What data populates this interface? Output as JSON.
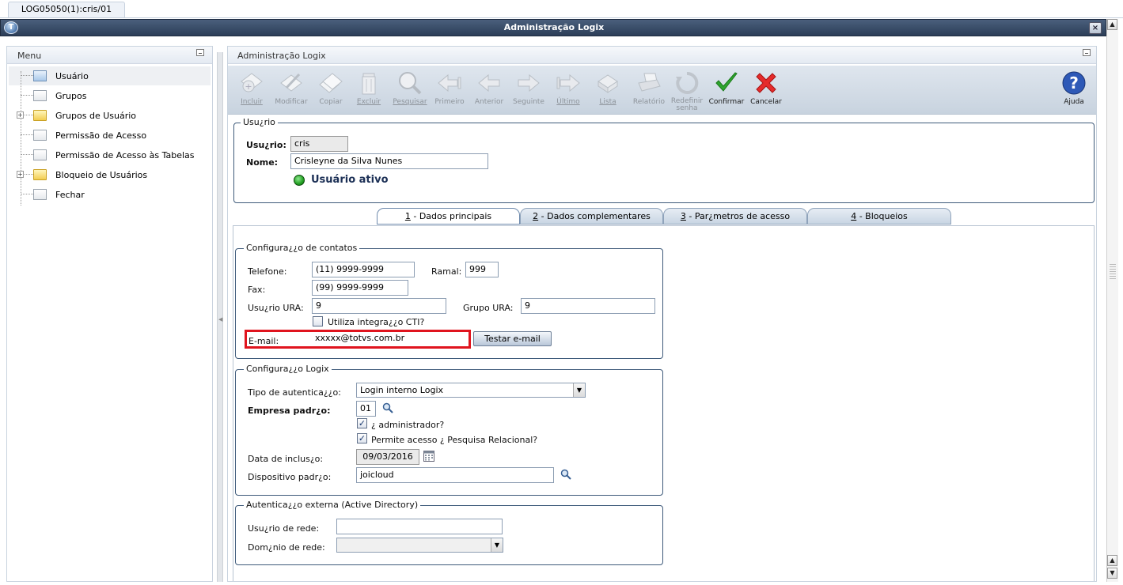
{
  "doc_tab": "LOG05050(1):cris/01",
  "window": {
    "title": "Administração Logix",
    "close_glyph": "×"
  },
  "menu": {
    "title": "Menu",
    "items": [
      {
        "label": "Usuário",
        "icon": "form-icon"
      },
      {
        "label": "Grupos",
        "icon": "form-icon"
      },
      {
        "label": "Grupos de Usuário",
        "icon": "folder-icon"
      },
      {
        "label": "Permissão de Acesso",
        "icon": "form-icon"
      },
      {
        "label": "Permissão de Acesso às Tabelas",
        "icon": "form-icon"
      },
      {
        "label": "Bloqueio de Usuários",
        "icon": "folder-icon"
      },
      {
        "label": "Fechar",
        "icon": "form-icon"
      }
    ]
  },
  "main": {
    "title": "Administração Logix",
    "toolbar": {
      "incluir": "Incluir",
      "modificar": "Modificar",
      "copiar": "Copiar",
      "excluir": "Excluir",
      "pesquisar": "Pesquisar",
      "primeiro": "Primeiro",
      "anterior": "Anterior",
      "seguinte": "Seguinte",
      "ultimo": "Último",
      "lista": "Lista",
      "relatorio": "Relatório",
      "redefinir": "Redefinir",
      "redefinir2": "senha",
      "confirmar": "Confirmar",
      "cancelar": "Cancelar",
      "ajuda": "Ajuda"
    },
    "usuario_frame": {
      "legend": "Usu¿rio",
      "usuario_label": "Usu¿rio:",
      "usuario_value": "cris",
      "nome_label": "Nome:",
      "nome_value": "Crisleyne da Silva Nunes",
      "status": "Usuário ativo",
      "status_color": "#22a022"
    },
    "tabs": [
      {
        "num": "1",
        "label": " - Dados principais"
      },
      {
        "num": "2",
        "label": " - Dados complementares"
      },
      {
        "num": "3",
        "label": " - Par¿metros de acesso"
      },
      {
        "num": "4",
        "label": " - Bloqueios"
      }
    ],
    "contatos": {
      "legend": "Configura¿¿o de contatos",
      "telefone_label": "Telefone:",
      "telefone_value": "(11) 9999-9999",
      "ramal_label": "Ramal:",
      "ramal_value": "999",
      "fax_label": "Fax:",
      "fax_value": "(99) 9999-9999",
      "usuario_ura_label": "Usu¿rio URA:",
      "usuario_ura_value": "9",
      "grupo_ura_label": "Grupo URA:",
      "grupo_ura_value": "9",
      "cti_label": "Utiliza integra¿¿o CTI?",
      "email_label": "E-mail:",
      "email_value": "xxxxx@totvs.com.br",
      "testar_label": "Testar e-mail",
      "highlight_color": "#e0141e"
    },
    "logix": {
      "legend": "Configura¿¿o Logix",
      "tipo_label": "Tipo de autentica¿¿o:",
      "tipo_value": "Login interno Logix",
      "empresa_label": "Empresa padr¿o:",
      "empresa_value": "01",
      "admin_label": "¿ administrador?",
      "permite_label": "Permite acesso ¿ Pesquisa Relacional?",
      "data_label": "Data de inclus¿o:",
      "data_value": "09/03/2016",
      "dispositivo_label": "Dispositivo padr¿o:",
      "dispositivo_value": "joicloud"
    },
    "ad": {
      "legend": "Autentica¿¿o externa (Active Directory)",
      "usuario_rede_label": "Usu¿rio de rede:",
      "usuario_rede_value": "",
      "dominio_label": "Dom¿nio de rede:",
      "dominio_value": ""
    }
  }
}
